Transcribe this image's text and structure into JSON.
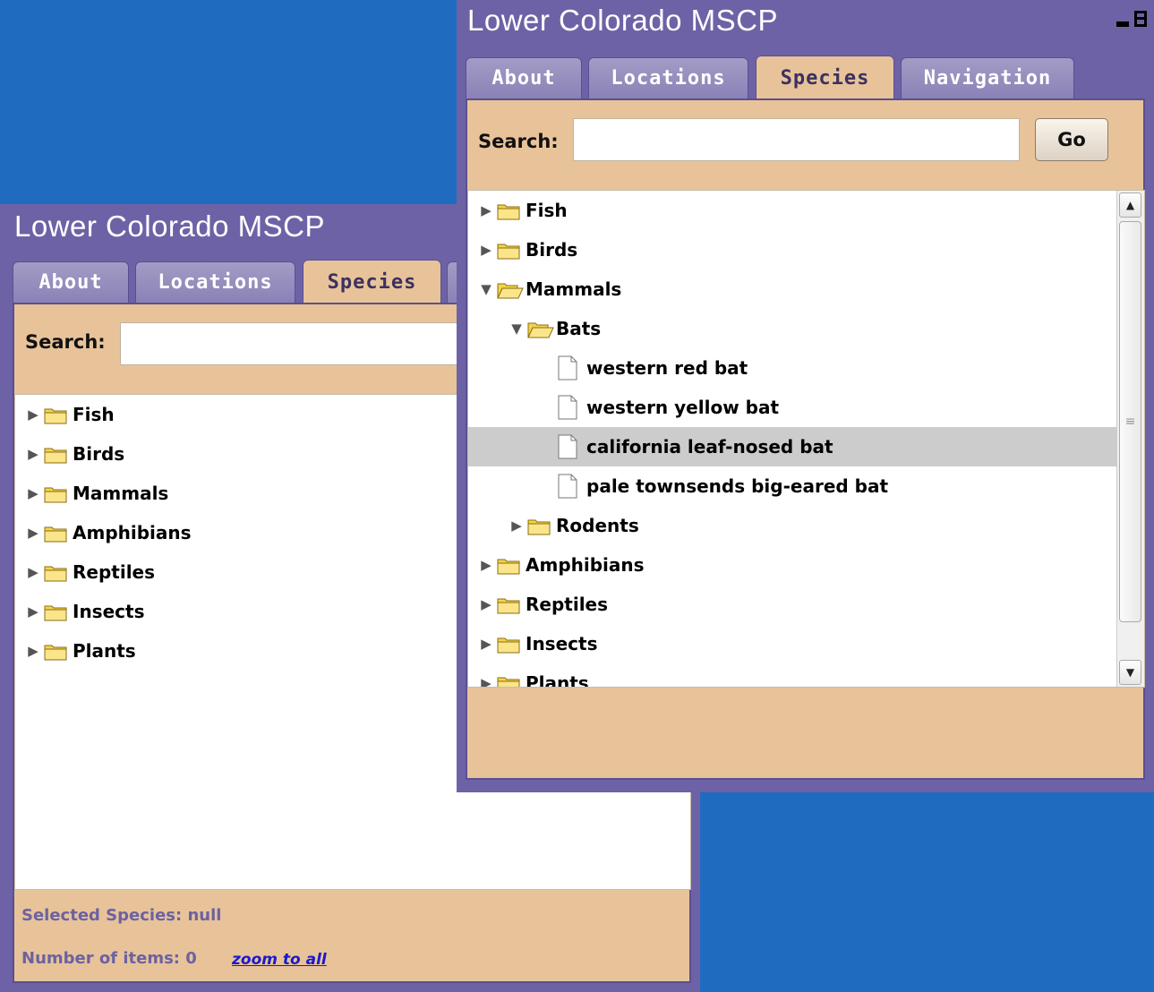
{
  "back_window": {
    "title": "Lower Colorado MSCP",
    "tabs": [
      {
        "label": "About"
      },
      {
        "label": "Locations"
      },
      {
        "label": "Species"
      }
    ],
    "active_tab": "Species",
    "search": {
      "label": "Search:",
      "value": ""
    },
    "tree": [
      {
        "label": "Fish",
        "expanded": false
      },
      {
        "label": "Birds",
        "expanded": false
      },
      {
        "label": "Mammals",
        "expanded": false
      },
      {
        "label": "Amphibians",
        "expanded": false
      },
      {
        "label": "Reptiles",
        "expanded": false
      },
      {
        "label": "Insects",
        "expanded": false
      },
      {
        "label": "Plants",
        "expanded": false
      }
    ],
    "status": {
      "selected_species": "Selected Species: null",
      "number_of_items": "Number of items: 0",
      "zoom_link": "zoom to all"
    }
  },
  "front_window": {
    "title": "Lower Colorado MSCP",
    "tabs": [
      {
        "label": "About"
      },
      {
        "label": "Locations"
      },
      {
        "label": "Species"
      },
      {
        "label": "Navigation"
      }
    ],
    "active_tab": "Species",
    "search": {
      "label": "Search:",
      "value": "",
      "go_label": "Go"
    },
    "tree": [
      {
        "label": "Fish",
        "type": "folder",
        "expanded": false,
        "depth": 0
      },
      {
        "label": "Birds",
        "type": "folder",
        "expanded": false,
        "depth": 0
      },
      {
        "label": "Mammals",
        "type": "folder",
        "expanded": true,
        "depth": 0
      },
      {
        "label": "Bats",
        "type": "folder",
        "expanded": true,
        "depth": 1
      },
      {
        "label": "western red bat",
        "type": "leaf",
        "depth": 2
      },
      {
        "label": "western yellow bat",
        "type": "leaf",
        "depth": 2
      },
      {
        "label": "california leaf-nosed bat",
        "type": "leaf",
        "depth": 2,
        "selected": true
      },
      {
        "label": "pale townsends big-eared bat",
        "type": "leaf",
        "depth": 2
      },
      {
        "label": "Rodents",
        "type": "folder",
        "expanded": false,
        "depth": 1
      },
      {
        "label": "Amphibians",
        "type": "folder",
        "expanded": false,
        "depth": 0
      },
      {
        "label": "Reptiles",
        "type": "folder",
        "expanded": false,
        "depth": 0
      },
      {
        "label": "Insects",
        "type": "folder",
        "expanded": false,
        "depth": 0
      },
      {
        "label": "Plants",
        "type": "folder",
        "expanded": false,
        "depth": 0
      }
    ]
  },
  "colors": {
    "desktop": "#1f6bc0",
    "window_frame": "#6e62a6",
    "content_bg": "#e8c39a",
    "selected_row": "#cccccc",
    "folder": "#f5d44a"
  }
}
